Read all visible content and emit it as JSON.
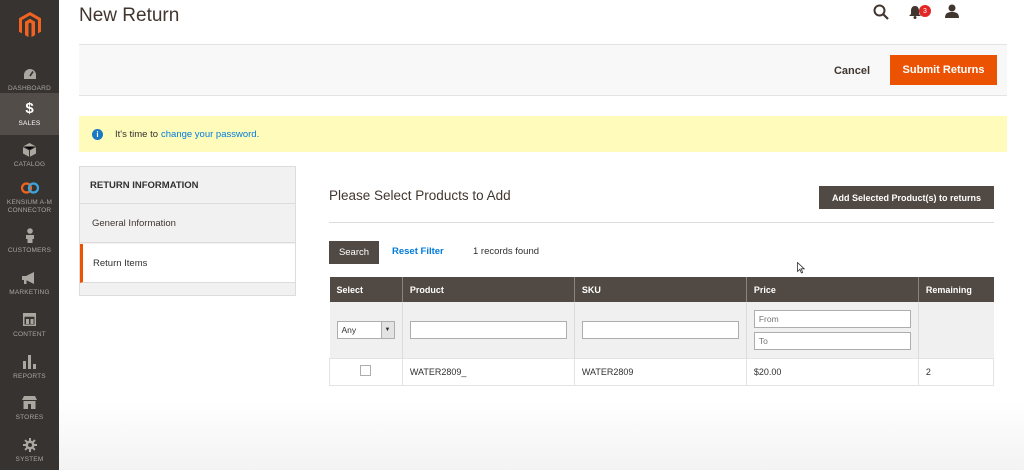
{
  "header": {
    "title": "New Return",
    "notification_count": "3"
  },
  "sidebar": {
    "items": [
      {
        "label": "Dashboard",
        "icon": "dashboard-icon",
        "active": false
      },
      {
        "label": "Sales",
        "icon": "dollar-icon",
        "active": true
      },
      {
        "label": "Catalog",
        "icon": "box-icon",
        "active": false
      },
      {
        "label": "Kensium A-M Connector",
        "icon": "connector-icon",
        "active": false
      },
      {
        "label": "Customers",
        "icon": "person-icon",
        "active": false
      },
      {
        "label": "Marketing",
        "icon": "megaphone-icon",
        "active": false
      },
      {
        "label": "Content",
        "icon": "layout-icon",
        "active": false
      },
      {
        "label": "Reports",
        "icon": "bar-chart-icon",
        "active": false
      },
      {
        "label": "Stores",
        "icon": "store-icon",
        "active": false
      },
      {
        "label": "System",
        "icon": "gear-icon",
        "active": false
      }
    ]
  },
  "actions": {
    "cancel_label": "Cancel",
    "submit_label": "Submit Returns"
  },
  "message": {
    "text": "It's time to",
    "link_text": "change your password."
  },
  "tabs": {
    "heading": "RETURN INFORMATION",
    "items": [
      {
        "label": "General Information",
        "active": false
      },
      {
        "label": "Return Items",
        "active": true
      }
    ]
  },
  "content": {
    "title": "Please Select Products to Add",
    "add_button_label": "Add Selected Product(s) to returns",
    "search_label": "Search",
    "reset_filter_label": "Reset Filter",
    "records_text": "1 records found"
  },
  "grid": {
    "columns": [
      "Select",
      "Product",
      "SKU",
      "Price",
      "Remaining"
    ],
    "filters": {
      "select_value": "Any",
      "product_value": "",
      "sku_value": "",
      "price_from_placeholder": "From",
      "price_to_placeholder": "To"
    },
    "rows": [
      {
        "checked": false,
        "product": "WATER2809_",
        "sku": "WATER2809",
        "price": "$20.00",
        "remaining": "2"
      }
    ]
  },
  "colors": {
    "sidebar_bg": "#373330",
    "accent_orange": "#eb5202",
    "dark_button": "#514943",
    "link_blue": "#007bdb",
    "message_bg": "#fffbbb"
  }
}
